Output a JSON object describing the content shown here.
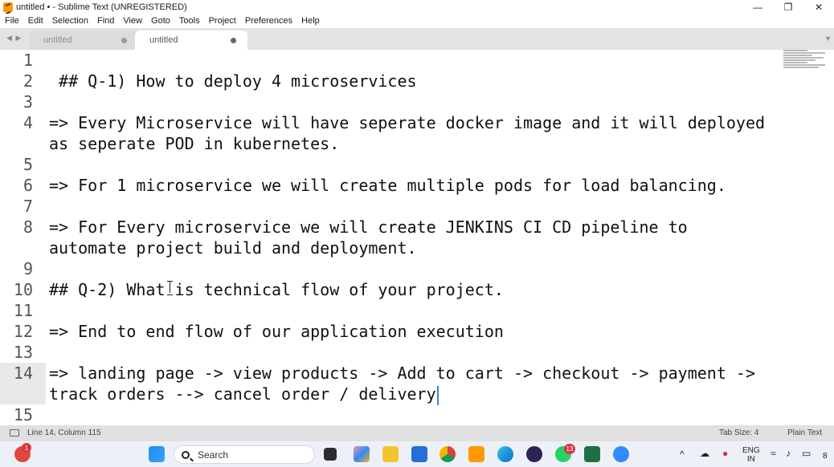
{
  "window": {
    "title": "untitled • - Sublime Text (UNREGISTERED)",
    "controls": [
      "—",
      "❐",
      "✕"
    ]
  },
  "menu": [
    "File",
    "Edit",
    "Selection",
    "Find",
    "View",
    "Goto",
    "Tools",
    "Project",
    "Preferences",
    "Help"
  ],
  "tabs": [
    {
      "label": "untitled",
      "active": false
    },
    {
      "label": "untitled",
      "active": true
    }
  ],
  "tab_nav": "◀ ▶",
  "tab_overflow": "▼",
  "editor": {
    "lines": [
      {
        "n": "1",
        "text": ""
      },
      {
        "n": "2",
        "text": " ## Q-1) How to deploy 4 microservices"
      },
      {
        "n": "3",
        "text": ""
      },
      {
        "n": "4",
        "text": "=> Every Microservice will have seperate docker image and it will deployed"
      },
      {
        "n": "",
        "text": "as seperate POD in kubernetes."
      },
      {
        "n": "5",
        "text": ""
      },
      {
        "n": "6",
        "text": "=> For 1 microservice we will create multiple pods for load balancing."
      },
      {
        "n": "7",
        "text": ""
      },
      {
        "n": "8",
        "text": "=> For Every microservice we will create JENKINS CI CD pipeline to"
      },
      {
        "n": "",
        "text": "automate project build and deployment."
      },
      {
        "n": "9",
        "text": ""
      },
      {
        "n": "10",
        "text": "## Q-2) What is technical flow of your project."
      },
      {
        "n": "11",
        "text": ""
      },
      {
        "n": "12",
        "text": "=> End to end flow of our application execution"
      },
      {
        "n": "13",
        "text": ""
      },
      {
        "n": "14",
        "text": "=> landing page -> view products -> Add to cart -> checkout -> payment ->"
      },
      {
        "n": "",
        "text": "track orders --> cancel order / delivery"
      },
      {
        "n": "15",
        "text": ""
      }
    ],
    "active_line": "14",
    "caret_color": "#2b8ad8"
  },
  "status": {
    "position": "Line 14, Column 115",
    "tab_size": "Tab Size: 4",
    "syntax": "Plain Text"
  },
  "taskbar": {
    "search_placeholder": "Search",
    "lang_top": "ENG",
    "lang_bottom": "IN",
    "notification_count": "1",
    "whatsapp_count": "13",
    "clock_fragment": "8",
    "icons": [
      "windows-start-icon",
      "search-icon",
      "file-explorer-icon",
      "copilot-icon",
      "folder-icon",
      "store-icon",
      "chrome-icon",
      "sublime-text-icon",
      "edge-icon",
      "eclipse-icon",
      "whatsapp-icon",
      "excel-icon",
      "zoom-icon"
    ]
  }
}
